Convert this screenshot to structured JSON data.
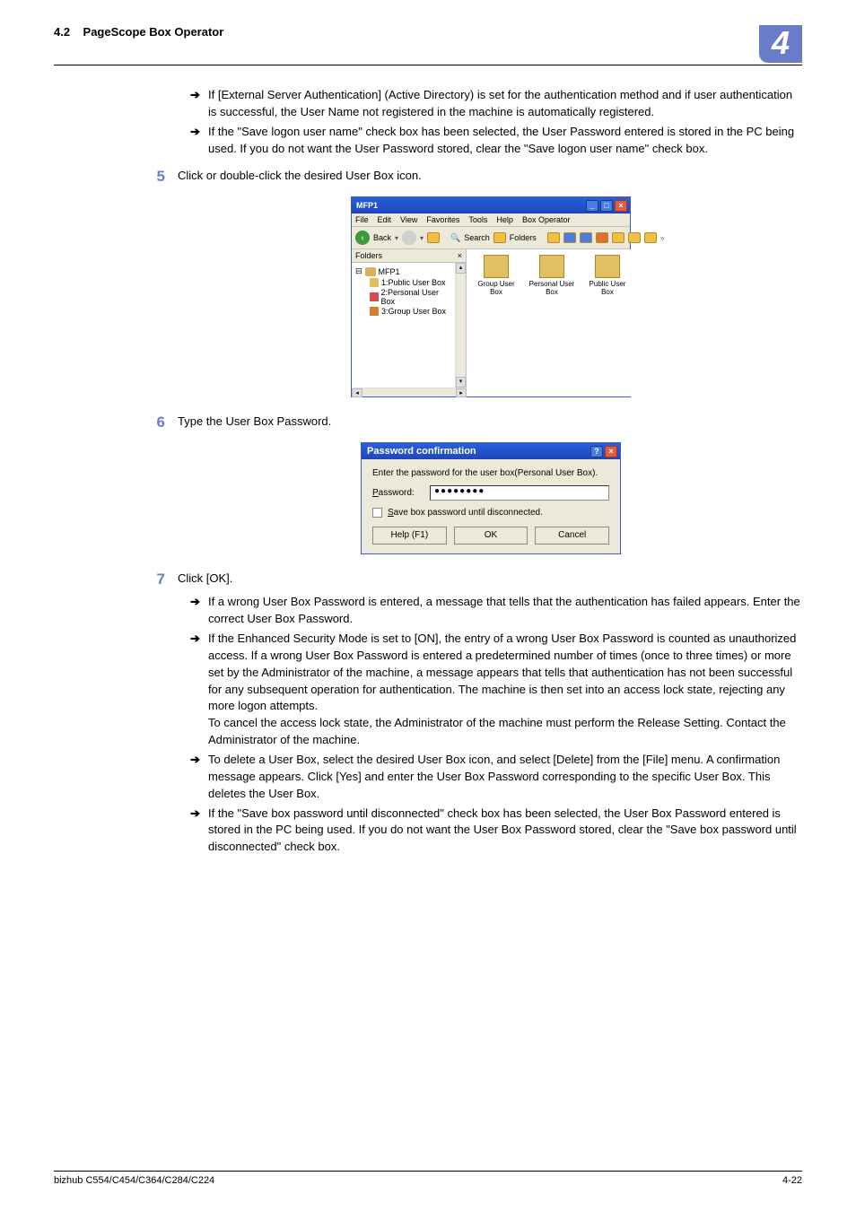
{
  "header": {
    "section": "4.2",
    "title": "PageScope Box Operator",
    "chapter": "4"
  },
  "bullets_pre": [
    "If [External Server Authentication] (Active Directory) is set for the authentication method and if user authentication is successful, the User Name not registered in the machine is automatically registered.",
    "If the \"Save logon user name\" check box has been selected, the User Password entered is stored in the PC being used. If you do not want the User Password stored, clear the \"Save logon user name\" check box."
  ],
  "step5": {
    "num": "5",
    "text": "Click or double-click the desired User Box icon."
  },
  "mfp": {
    "title": "MFP1",
    "menu": [
      "File",
      "Edit",
      "View",
      "Favorites",
      "Tools",
      "Help",
      "Box Operator"
    ],
    "back": "Back",
    "search": "Search",
    "folders": "Folders",
    "folders_hdr": "Folders",
    "tree_root": "MFP1",
    "tree_items": [
      "1:Public User Box",
      "2:Personal User Box",
      "3:Group User Box"
    ],
    "boxes": [
      {
        "label": "Group User Box"
      },
      {
        "label": "Personal User Box"
      },
      {
        "label": "Public User Box"
      }
    ]
  },
  "step6": {
    "num": "6",
    "text": "Type the User Box Password."
  },
  "pwd": {
    "title": "Password confirmation",
    "instruction": "Enter the password for the user box(Personal User Box).",
    "label": "Password:",
    "value": "●●●●●●●●",
    "checkbox": "Save box password until disconnected.",
    "help": "Help (F1)",
    "ok": "OK",
    "cancel": "Cancel"
  },
  "step7": {
    "num": "7",
    "text": "Click [OK].",
    "bullets": [
      "If a wrong User Box Password is entered, a message that tells that the authentication has failed appears. Enter the correct User Box Password.",
      "If the Enhanced Security Mode is set to [ON], the entry of a wrong User Box Password is counted as unauthorized access. If a wrong User Box Password is entered a predetermined number of times (once to three times) or more set by the Administrator of the machine, a message appears that tells that authentication has not been successful for any subsequent operation for authentication. The machine is then set into an access lock state, rejecting any more logon attempts.\nTo cancel the access lock state, the Administrator of the machine must perform the Release Setting. Contact the Administrator of the machine.",
      "To delete a User Box, select the desired User Box icon, and select [Delete] from the [File] menu. A confirmation message appears. Click [Yes] and enter the User Box Password corresponding to the specific User Box. This deletes the User Box.",
      "If the \"Save box password until disconnected\" check box has been selected, the User Box Password entered is stored in the PC being used. If you do not want the User Box Password stored, clear the \"Save box password until disconnected\" check box."
    ]
  },
  "footer": {
    "model": "bizhub C554/C454/C364/C284/C224",
    "page": "4-22"
  }
}
